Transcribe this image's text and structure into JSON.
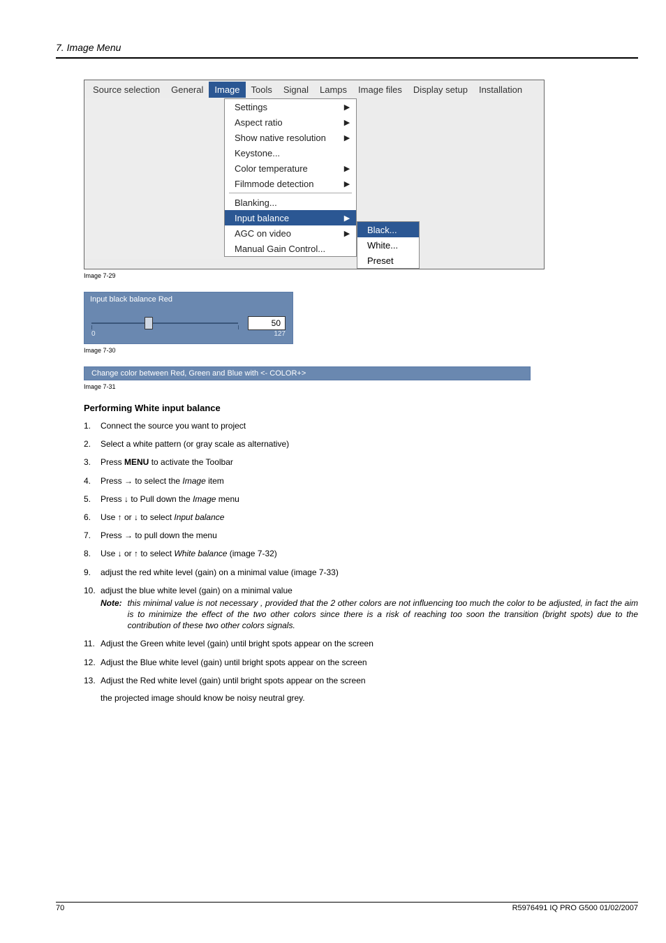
{
  "header": {
    "title": "7. Image Menu"
  },
  "menubar": {
    "items": [
      "Source selection",
      "General",
      "Image",
      "Tools",
      "Signal",
      "Lamps",
      "Image files",
      "Display setup",
      "Installation"
    ],
    "selected_index": 2
  },
  "dropdown": {
    "items": [
      {
        "label": "Settings",
        "arrow": true,
        "sel": false
      },
      {
        "label": "Aspect ratio",
        "arrow": true,
        "sel": false
      },
      {
        "label": "Show native resolution",
        "arrow": true,
        "sel": false
      },
      {
        "label": "Keystone...",
        "arrow": false,
        "sel": false
      },
      {
        "label": "Color temperature",
        "arrow": true,
        "sel": false
      },
      {
        "label": "Filmmode detection",
        "arrow": true,
        "sel": false
      },
      {
        "label": "__sep__",
        "arrow": false,
        "sel": false
      },
      {
        "label": "Blanking...",
        "arrow": false,
        "sel": false
      },
      {
        "label": "Input balance",
        "arrow": true,
        "sel": true
      },
      {
        "label": "AGC on video",
        "arrow": true,
        "sel": false
      },
      {
        "label": "Manual Gain Control...",
        "arrow": false,
        "sel": false
      }
    ]
  },
  "submenu": {
    "items": [
      {
        "label": "Black...",
        "sel": true
      },
      {
        "label": "White...",
        "sel": false
      },
      {
        "label": "Preset",
        "sel": false
      }
    ]
  },
  "caption1": "Image 7-29",
  "slider": {
    "title": "Input black balance Red",
    "min": "0",
    "max": "127",
    "value": "50",
    "thumb_pct": 39
  },
  "caption2": "Image 7-30",
  "hint": "Change color between Red, Green and Blue with <- COLOR+>",
  "caption3": "Image 7-31",
  "section": "Performing White input balance",
  "steps": [
    {
      "n": "1.",
      "t": "Connect the source you want to project"
    },
    {
      "n": "2.",
      "t": "Select a white pattern (or gray scale as alternative)"
    },
    {
      "n": "3.",
      "t": "Press <b>MENU</b> to activate the Toolbar"
    },
    {
      "n": "4.",
      "t": "Press → to select the <span class='ital'>Image</span> item"
    },
    {
      "n": "5.",
      "t": "Press ↓ to Pull down the <span class='ital'>Image</span> menu"
    },
    {
      "n": "6.",
      "t": "Use ↑ or ↓ to select <span class='ital'>Input balance</span>"
    },
    {
      "n": "7.",
      "t": "Press → to pull down the menu"
    },
    {
      "n": "8.",
      "t": "Use ↓ or ↑ to select <span class='ital'>White balance</span> (image 7-32)"
    },
    {
      "n": "9.",
      "t": "adjust the red white level (gain) on a minimal value (image 7-33)"
    },
    {
      "n": "10.",
      "t": "adjust the blue white level (gain) on a minimal value",
      "note_label": "Note:",
      "note": "this minimal value is not necessary , provided that the 2 other colors are not influencing too much the color to be adjusted, in fact the aim is to minimize the effect of the two other colors since there is a risk of reaching too soon the transition (bright spots) due to the contribution of these two other colors signals."
    },
    {
      "n": "11.",
      "t": "Adjust the Green white level (gain) until bright spots appear on the screen"
    },
    {
      "n": "12.",
      "t": "Adjust the Blue white level (gain) until bright spots appear on the screen"
    },
    {
      "n": "13.",
      "t": "Adjust the Red white level (gain) until bright spots appear on the screen"
    }
  ],
  "tail": "the projected image should know be noisy neutral grey.",
  "footer": {
    "page": "70",
    "doc": "R5976491  IQ PRO G500  01/02/2007"
  }
}
